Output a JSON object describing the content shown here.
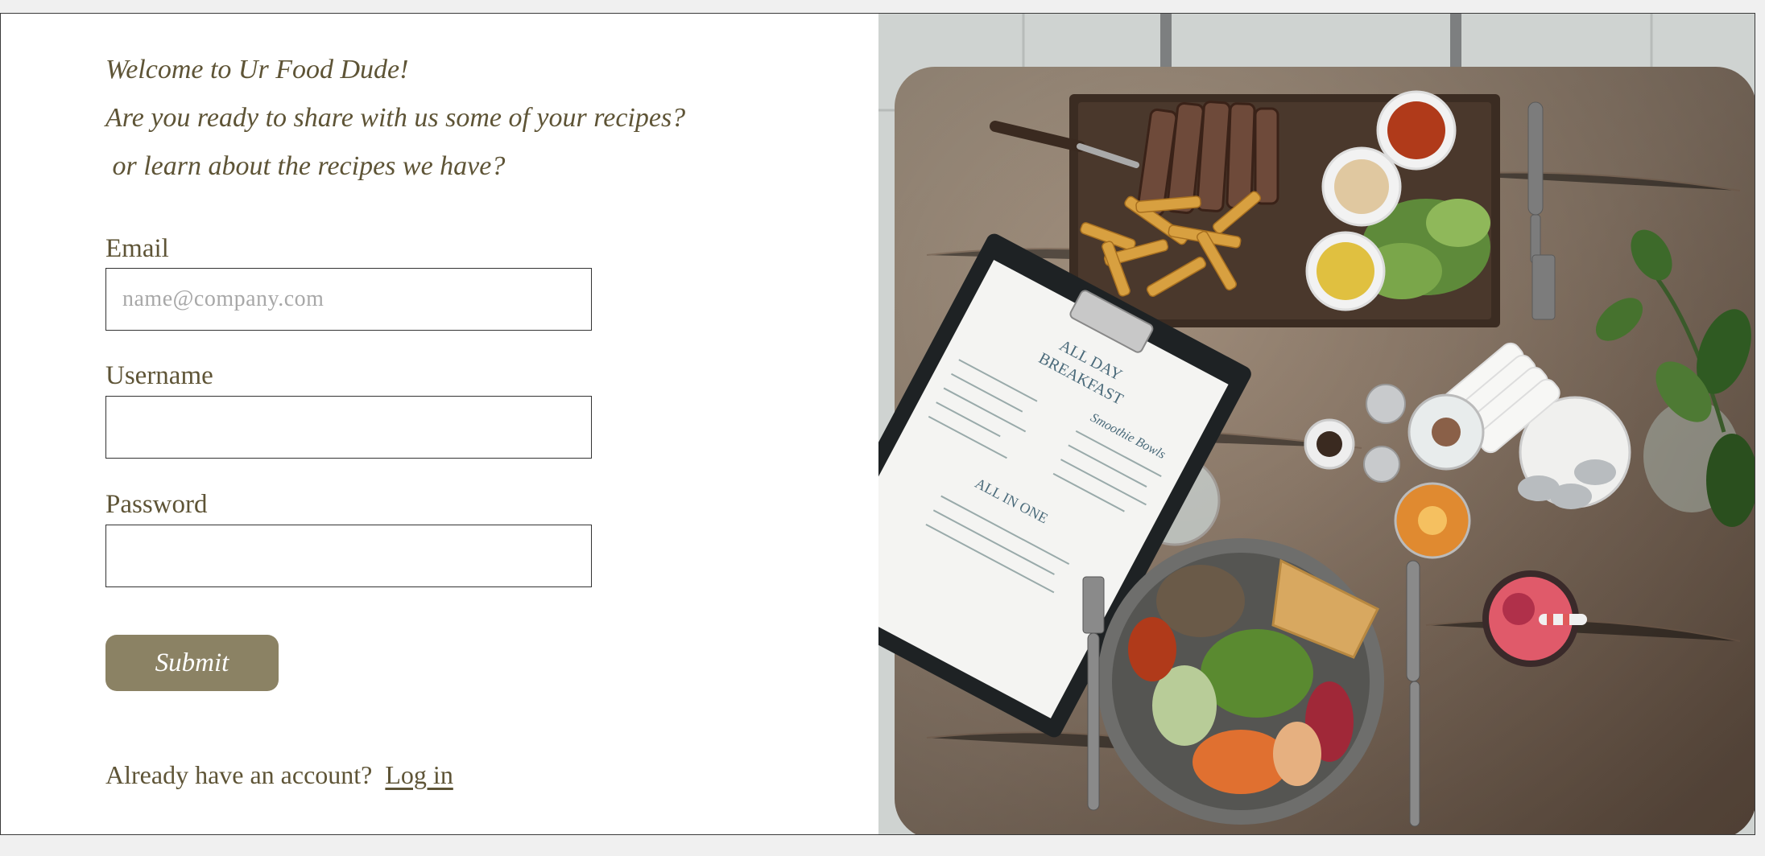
{
  "welcome": {
    "line1": "Welcome to Ur Food Dude!",
    "line2": "Are you ready to share with us some of your recipes?",
    "line3": " or learn about the recipes we have?"
  },
  "form": {
    "email_label": "Email",
    "email_placeholder": "name@company.com",
    "email_value": "",
    "username_label": "Username",
    "username_value": "",
    "password_label": "Password",
    "password_value": "",
    "submit_label": "Submit"
  },
  "footer": {
    "prompt": "Already have an account? ",
    "login_link": "Log in"
  },
  "photo": {
    "menu_title_1": "ALL DAY",
    "menu_title_2": "BREAKFAST",
    "menu_section_1": "Smoothie Bowls",
    "menu_section_2": "ALL IN ONE"
  },
  "colors": {
    "text": "#5e5436",
    "button": "#8b8264",
    "button_text": "#ffffff",
    "input_border": "#333333"
  }
}
